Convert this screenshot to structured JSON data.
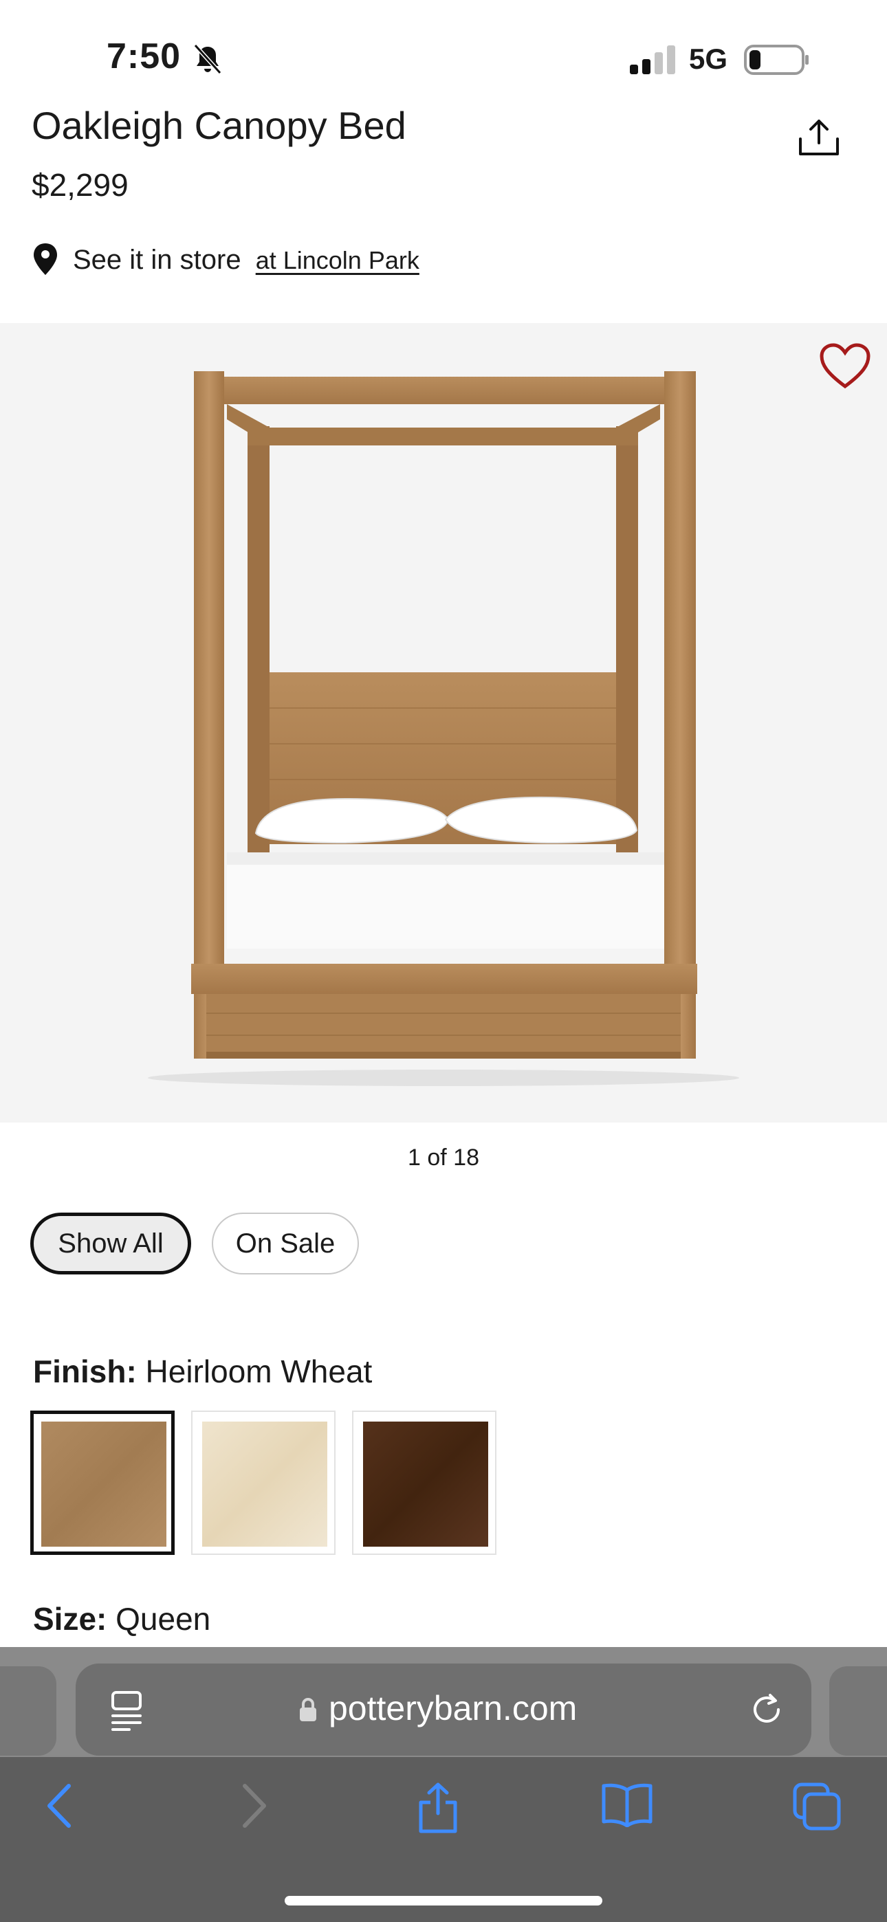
{
  "status_bar": {
    "time": "7:50",
    "network": "5G"
  },
  "product": {
    "title": "Oakleigh Canopy Bed",
    "price": "$2,299",
    "store_prefix": "See it in store",
    "store_link": "at Lincoln Park",
    "image_counter": "1 of 18"
  },
  "filters": {
    "show_all": "Show All",
    "on_sale": "On Sale"
  },
  "finish": {
    "label": "Finish:",
    "value": "Heirloom Wheat",
    "swatch_colors": [
      "#a9825a",
      "#ece0c8",
      "#4b2a17"
    ]
  },
  "size": {
    "label": "Size:",
    "value": "Queen"
  },
  "browser": {
    "url": "potterybarn.com"
  },
  "colors": {
    "heart": "#a61b1b",
    "toolbar_icon": "#3f8cff",
    "wood": "#b58a5c"
  }
}
